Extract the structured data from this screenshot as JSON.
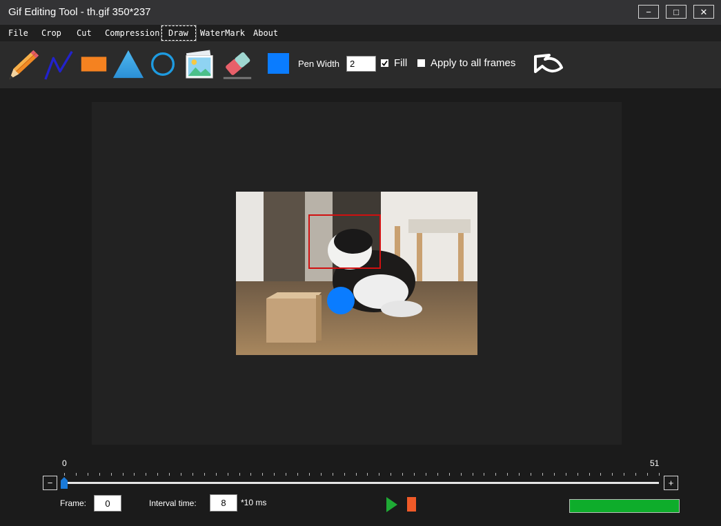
{
  "window": {
    "title": "Gif Editing Tool - th.gif 350*237",
    "minimize_glyph": "−",
    "maximize_glyph": "□",
    "close_glyph": "✕"
  },
  "menu": {
    "items": [
      "File",
      "Crop",
      "Cut",
      "Compression",
      "Draw",
      "WaterMark",
      "About"
    ],
    "active": "Draw"
  },
  "toolbar": {
    "tools": [
      "pencil-icon",
      "polyline-icon",
      "rectangle-icon",
      "triangle-icon",
      "circle-icon",
      "image-icon",
      "eraser-icon"
    ],
    "color": "#0a7cff",
    "pen_width_label": "Pen Width",
    "pen_width_value": "2",
    "fill_label": "Fill",
    "fill_checked": true,
    "apply_all_label": "Apply to all frames",
    "apply_all_checked": false,
    "undo_icon": "undo-icon"
  },
  "canvas": {
    "gif_description_icon": "image-frame",
    "rect_color": "#d01010",
    "circle_color": "#0a7cff"
  },
  "timeline": {
    "min_label": "0",
    "max_label": "51",
    "current_frame": 0,
    "minus_glyph": "−",
    "plus_glyph": "+",
    "frame_label": "Frame:",
    "frame_value": "0",
    "interval_label": "Interval time:",
    "interval_value": "8",
    "interval_unit": "*10 ms",
    "play_color": "#1faa35",
    "stop_color": "#f05a28",
    "progress_color": "#0ead2b",
    "progress": 1.0
  }
}
